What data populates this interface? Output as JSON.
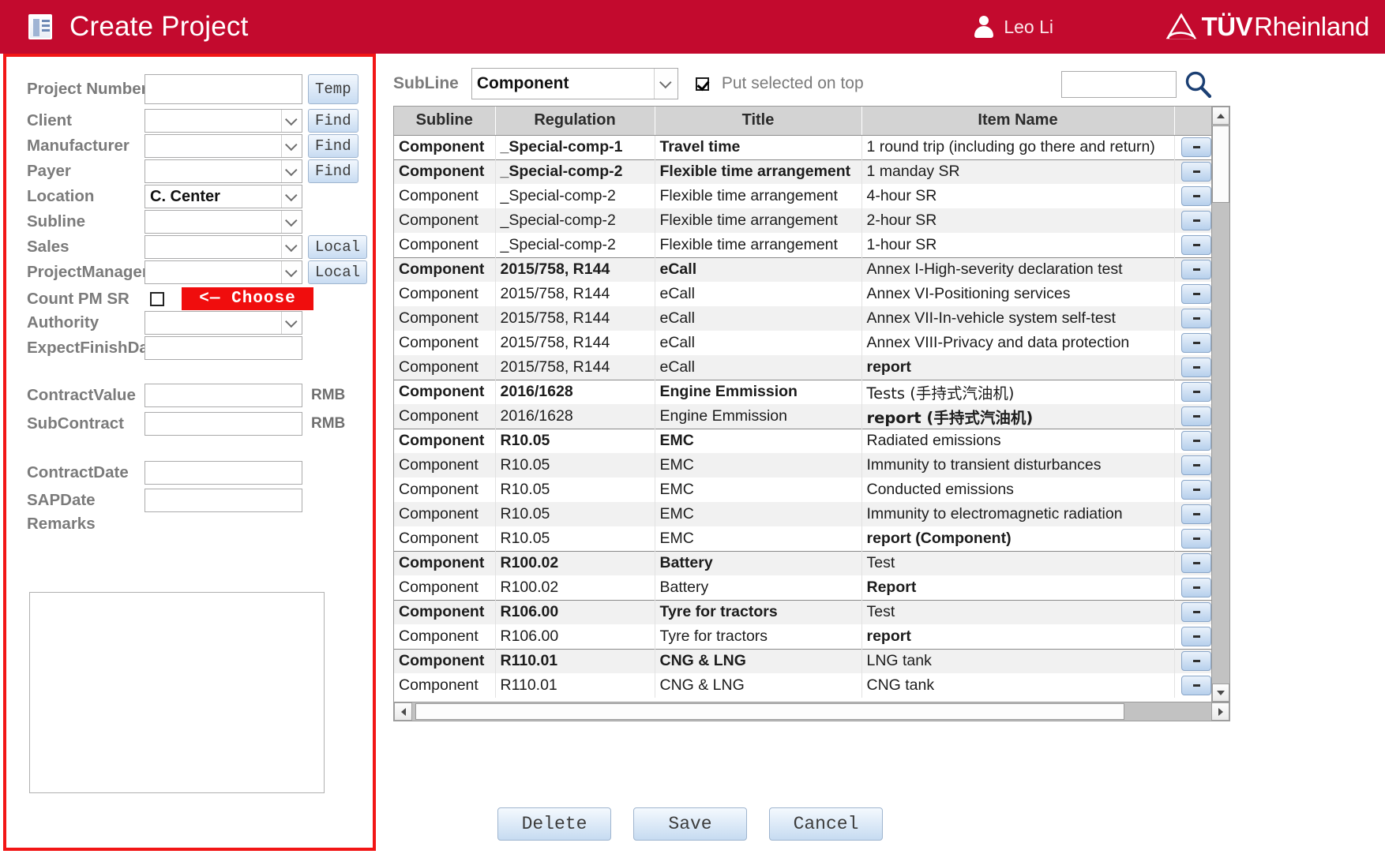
{
  "header": {
    "title": "Create Project",
    "user_name": "Leo Li",
    "brand_primary": "TÜV",
    "brand_secondary": "Rheinland",
    "background_color": "#c30a2e"
  },
  "form": {
    "accent_color": "#f21616",
    "fields": [
      {
        "label": "Project Number",
        "value": "",
        "control": "text",
        "button": "Temp"
      },
      {
        "label": "Client",
        "value": "",
        "control": "select",
        "button": "Find"
      },
      {
        "label": "Manufacturer",
        "value": "",
        "control": "select",
        "button": "Find"
      },
      {
        "label": "Payer",
        "value": "",
        "control": "select",
        "button": "Find"
      },
      {
        "label": "Location",
        "value": "C. Center",
        "control": "select",
        "button": ""
      },
      {
        "label": "Subline",
        "value": "",
        "control": "select",
        "button": ""
      },
      {
        "label": "Sales",
        "value": "",
        "control": "select",
        "button": "Local"
      },
      {
        "label": "ProjectManager",
        "value": "",
        "control": "select",
        "button": "Local"
      },
      {
        "label": "Count PM SR",
        "value": "",
        "control": "checkbox",
        "button": ""
      },
      {
        "label": "Authority",
        "value": "",
        "control": "select",
        "button": ""
      },
      {
        "label": "ExpectFinishDate",
        "value": "",
        "control": "text",
        "button": ""
      },
      {
        "label": "ContractValue",
        "value": "",
        "control": "text",
        "unit": "RMB"
      },
      {
        "label": "SubContract",
        "value": "",
        "control": "text",
        "unit": "RMB"
      },
      {
        "label": "ContractDate",
        "value": "",
        "control": "text"
      },
      {
        "label": "SAPDate",
        "value": "",
        "control": "text"
      },
      {
        "label": "Remarks",
        "value": "",
        "control": "textarea"
      }
    ],
    "choose_button_label": "<—  Choose",
    "choose_button_color": "#f00d0d",
    "count_pm_sr_checked": false,
    "remarks_value": ""
  },
  "right": {
    "subline_label": "SubLine",
    "subline_value": "Component",
    "put_selected_label": "Put selected on top",
    "put_selected_checked": true,
    "search_value": "",
    "search_icon": "search-icon",
    "row_button_label": "-"
  },
  "table": {
    "columns": [
      "Subline",
      "Regulation",
      "Title",
      "Item Name"
    ],
    "rows": [
      {
        "subline": "Component",
        "regulation": "_Special-comp-1",
        "title": "Travel time",
        "item": "1 round trip (including go there and return)",
        "group_start": true,
        "faded": false,
        "shade": false,
        "link": false
      },
      {
        "subline": "Component",
        "regulation": "_Special-comp-2",
        "title": "Flexible time arrangement",
        "item": "1 manday SR",
        "group_start": true,
        "faded": false,
        "shade": true,
        "link": false
      },
      {
        "subline": "Component",
        "regulation": "_Special-comp-2",
        "title": "Flexible time arrangement",
        "item": "4-hour SR",
        "group_start": false,
        "faded": true,
        "shade": false,
        "link": false
      },
      {
        "subline": "Component",
        "regulation": "_Special-comp-2",
        "title": "Flexible time arrangement",
        "item": "2-hour SR",
        "group_start": false,
        "faded": true,
        "shade": true,
        "link": false
      },
      {
        "subline": "Component",
        "regulation": "_Special-comp-2",
        "title": "Flexible time arrangement",
        "item": "1-hour SR",
        "group_start": false,
        "faded": true,
        "shade": false,
        "link": false
      },
      {
        "subline": "Component",
        "regulation": "2015/758, R144",
        "title": "eCall",
        "item": "Annex I-High-severity declaration test",
        "group_start": true,
        "faded": false,
        "shade": true,
        "link": false
      },
      {
        "subline": "Component",
        "regulation": "2015/758, R144",
        "title": "eCall",
        "item": "Annex VI-Positioning services",
        "group_start": false,
        "faded": true,
        "shade": false,
        "link": false
      },
      {
        "subline": "Component",
        "regulation": "2015/758, R144",
        "title": "eCall",
        "item": "Annex VII-In-vehicle system self-test",
        "group_start": false,
        "faded": true,
        "shade": true,
        "link": false
      },
      {
        "subline": "Component",
        "regulation": "2015/758, R144",
        "title": "eCall",
        "item": "Annex VIII-Privacy and data protection",
        "group_start": false,
        "faded": true,
        "shade": false,
        "link": false
      },
      {
        "subline": "Component",
        "regulation": "2015/758, R144",
        "title": "eCall",
        "item": "report",
        "group_start": false,
        "faded": true,
        "shade": true,
        "link": true
      },
      {
        "subline": "Component",
        "regulation": "2016/1628",
        "title": "Engine Emmission",
        "item": "Tests (手持式汽油机)",
        "group_start": true,
        "faded": false,
        "shade": false,
        "link": false
      },
      {
        "subline": "Component",
        "regulation": "2016/1628",
        "title": "Engine Emmission",
        "item": "report (手持式汽油机)",
        "group_start": false,
        "faded": true,
        "shade": true,
        "link": true
      },
      {
        "subline": "Component",
        "regulation": "R10.05",
        "title": "EMC",
        "item": "Radiated emissions",
        "group_start": true,
        "faded": false,
        "shade": false,
        "link": false
      },
      {
        "subline": "Component",
        "regulation": "R10.05",
        "title": "EMC",
        "item": "Immunity to transient disturbances",
        "group_start": false,
        "faded": true,
        "shade": true,
        "link": false
      },
      {
        "subline": "Component",
        "regulation": "R10.05",
        "title": "EMC",
        "item": "Conducted emissions",
        "group_start": false,
        "faded": true,
        "shade": false,
        "link": false
      },
      {
        "subline": "Component",
        "regulation": "R10.05",
        "title": "EMC",
        "item": "Immunity to electromagnetic radiation",
        "group_start": false,
        "faded": true,
        "shade": true,
        "link": false
      },
      {
        "subline": "Component",
        "regulation": "R10.05",
        "title": "EMC",
        "item": "report (Component)",
        "group_start": false,
        "faded": true,
        "shade": false,
        "link": true
      },
      {
        "subline": "Component",
        "regulation": "R100.02",
        "title": "Battery",
        "item": "Test",
        "group_start": true,
        "faded": false,
        "shade": true,
        "link": false
      },
      {
        "subline": "Component",
        "regulation": "R100.02",
        "title": "Battery",
        "item": "Report",
        "group_start": false,
        "faded": true,
        "shade": false,
        "link": true
      },
      {
        "subline": "Component",
        "regulation": "R106.00",
        "title": "Tyre for tractors",
        "item": "Test",
        "group_start": true,
        "faded": false,
        "shade": true,
        "link": false
      },
      {
        "subline": "Component",
        "regulation": "R106.00",
        "title": "Tyre for tractors",
        "item": "report",
        "group_start": false,
        "faded": true,
        "shade": false,
        "link": true
      },
      {
        "subline": "Component",
        "regulation": "R110.01",
        "title": "CNG & LNG",
        "item": "LNG tank",
        "group_start": true,
        "faded": false,
        "shade": true,
        "link": false
      },
      {
        "subline": "Component",
        "regulation": "R110.01",
        "title": "CNG & LNG",
        "item": "CNG tank",
        "group_start": false,
        "faded": true,
        "shade": false,
        "link": false
      }
    ]
  },
  "footer": {
    "buttons": [
      {
        "label": "Delete",
        "name": "delete-button"
      },
      {
        "label": "Save",
        "name": "save-button"
      },
      {
        "label": "Cancel",
        "name": "cancel-button"
      }
    ]
  }
}
